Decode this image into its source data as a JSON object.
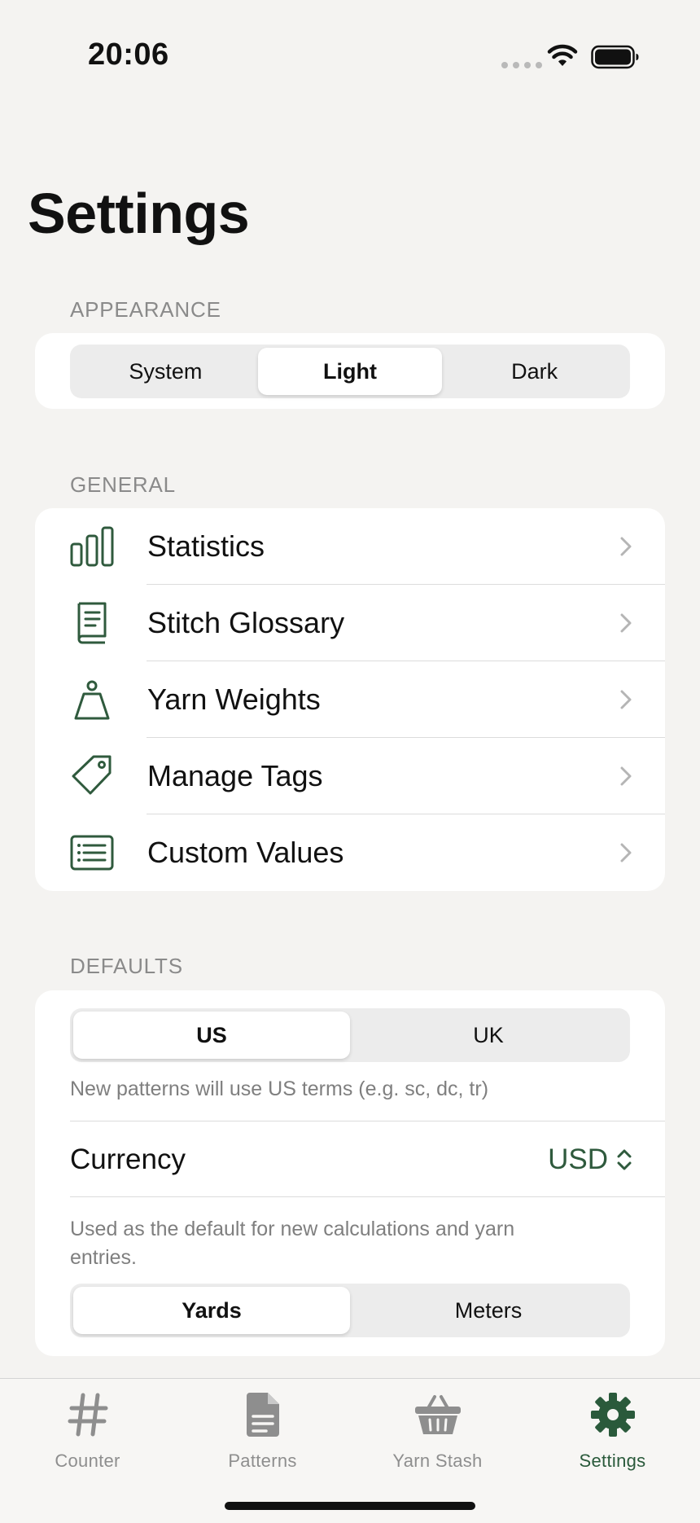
{
  "status_bar": {
    "time": "20:06"
  },
  "page": {
    "title": "Settings"
  },
  "appearance": {
    "header": "APPEARANCE",
    "options": [
      "System",
      "Light",
      "Dark"
    ],
    "selected": "Light"
  },
  "general": {
    "header": "GENERAL",
    "items": [
      {
        "label": "Statistics",
        "icon": "bar-chart-icon"
      },
      {
        "label": "Stitch Glossary",
        "icon": "book-icon"
      },
      {
        "label": "Yarn Weights",
        "icon": "weight-icon"
      },
      {
        "label": "Manage Tags",
        "icon": "tag-icon"
      },
      {
        "label": "Custom Values",
        "icon": "list-icon"
      }
    ]
  },
  "defaults": {
    "header": "DEFAULTS",
    "terms": {
      "options": [
        "US",
        "UK"
      ],
      "selected": "US"
    },
    "terms_caption": "New patterns will use US terms (e.g. sc, dc, tr)",
    "currency_label": "Currency",
    "currency_value": "USD",
    "units_caption": "Used as the default for new calculations and yarn entries.",
    "units": {
      "options": [
        "Yards",
        "Meters"
      ],
      "selected": "Yards"
    }
  },
  "tab_bar": {
    "tabs": [
      {
        "label": "Counter",
        "icon": "hash-icon"
      },
      {
        "label": "Patterns",
        "icon": "document-icon"
      },
      {
        "label": "Yarn Stash",
        "icon": "basket-icon"
      },
      {
        "label": "Settings",
        "icon": "gear-icon"
      }
    ],
    "active": "Settings"
  },
  "colors": {
    "accent": "#2f5a3d",
    "background": "#f4f3f1",
    "card": "#ffffff",
    "secondary_text": "#8a8a8a"
  }
}
